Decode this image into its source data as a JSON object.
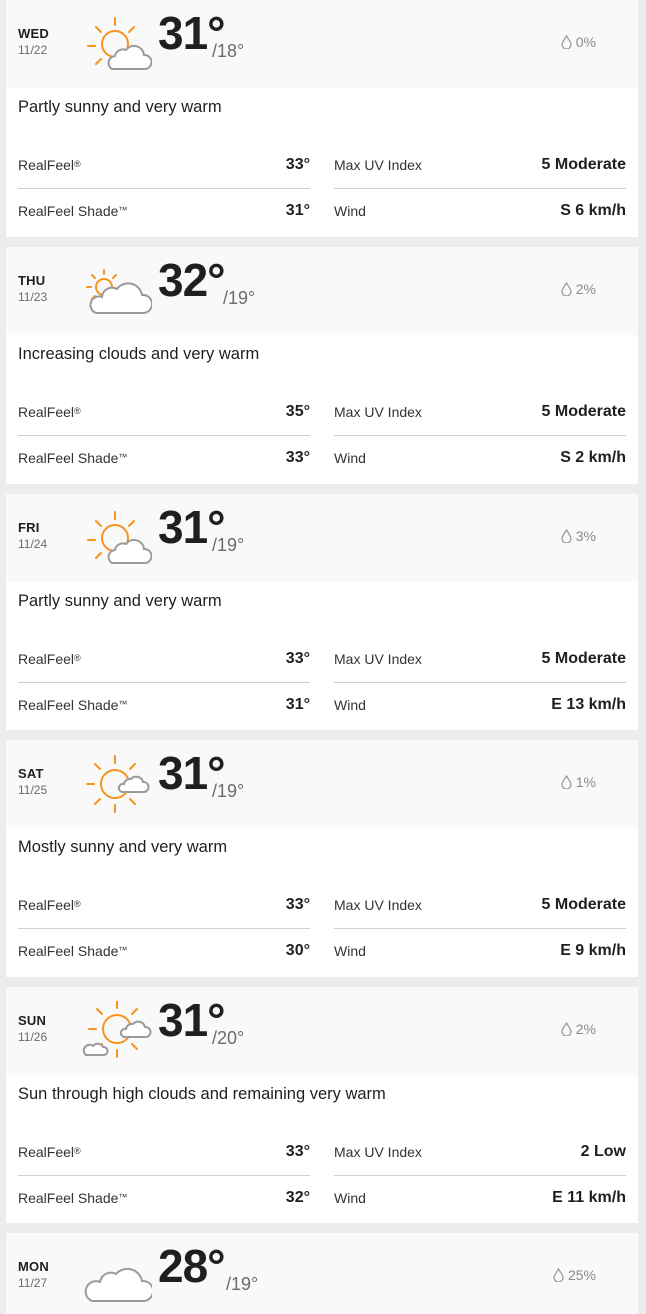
{
  "days": [
    {
      "dow": "WED",
      "date": "11/22",
      "icon": "partly-sunny-icon",
      "high": "31°",
      "low": "/18°",
      "precip": "0%",
      "phrase": "Partly sunny and very warm",
      "realfeel_label": "RealFeel",
      "realfeel": "33°",
      "realfeel_shade_label": "RealFeel Shade",
      "realfeel_shade": "31°",
      "uv_label": "Max UV Index",
      "uv": "5 Moderate",
      "wind_label": "Wind",
      "wind": "S 6 km/h"
    },
    {
      "dow": "THU",
      "date": "11/23",
      "icon": "increasing-clouds-icon",
      "high": "32°",
      "low": "/19°",
      "precip": "2%",
      "phrase": "Increasing clouds and very warm",
      "realfeel_label": "RealFeel",
      "realfeel": "35°",
      "realfeel_shade_label": "RealFeel Shade",
      "realfeel_shade": "33°",
      "uv_label": "Max UV Index",
      "uv": "5 Moderate",
      "wind_label": "Wind",
      "wind": "S 2 km/h"
    },
    {
      "dow": "FRI",
      "date": "11/24",
      "icon": "partly-sunny-icon",
      "high": "31°",
      "low": "/19°",
      "precip": "3%",
      "phrase": "Partly sunny and very warm",
      "realfeel_label": "RealFeel",
      "realfeel": "33°",
      "realfeel_shade_label": "RealFeel Shade",
      "realfeel_shade": "31°",
      "uv_label": "Max UV Index",
      "uv": "5 Moderate",
      "wind_label": "Wind",
      "wind": "E 13 km/h"
    },
    {
      "dow": "SAT",
      "date": "11/25",
      "icon": "mostly-sunny-icon",
      "high": "31°",
      "low": "/19°",
      "precip": "1%",
      "phrase": "Mostly sunny and very warm",
      "realfeel_label": "RealFeel",
      "realfeel": "33°",
      "realfeel_shade_label": "RealFeel Shade",
      "realfeel_shade": "30°",
      "uv_label": "Max UV Index",
      "uv": "5 Moderate",
      "wind_label": "Wind",
      "wind": "E 9 km/h"
    },
    {
      "dow": "SUN",
      "date": "11/26",
      "icon": "hazy-sunshine-icon",
      "high": "31°",
      "low": "/20°",
      "precip": "2%",
      "phrase": "Sun through high clouds and remaining very warm",
      "realfeel_label": "RealFeel",
      "realfeel": "33°",
      "realfeel_shade_label": "RealFeel Shade",
      "realfeel_shade": "32°",
      "uv_label": "Max UV Index",
      "uv": "2 Low",
      "wind_label": "Wind",
      "wind": "E 11 km/h"
    },
    {
      "dow": "MON",
      "date": "11/27",
      "icon": "cloudy-icon",
      "high": "28°",
      "low": "/19°",
      "precip": "25%"
    }
  ],
  "colors": {
    "sun": "#f7931e",
    "cloud": "#9a9a9a",
    "card": "#ffffff",
    "header": "#f9f9f9",
    "page": "#ececec"
  }
}
